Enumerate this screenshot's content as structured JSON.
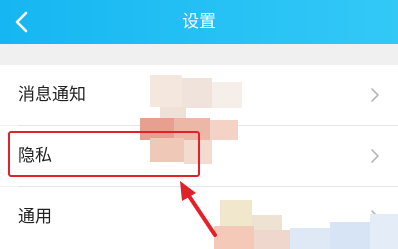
{
  "header": {
    "title": "设置",
    "back_icon": "chevron-left-icon",
    "color": "#1db9f3"
  },
  "settings": {
    "items": [
      {
        "label": "消息通知",
        "icon": "chevron-right-icon"
      },
      {
        "label": "隐私",
        "icon": "chevron-right-icon",
        "highlighted": true
      },
      {
        "label": "通用",
        "icon": "chevron-right-icon"
      }
    ]
  },
  "annotation": {
    "highlight_color": "#e0222b",
    "arrow_icon": "red-arrow-icon"
  }
}
